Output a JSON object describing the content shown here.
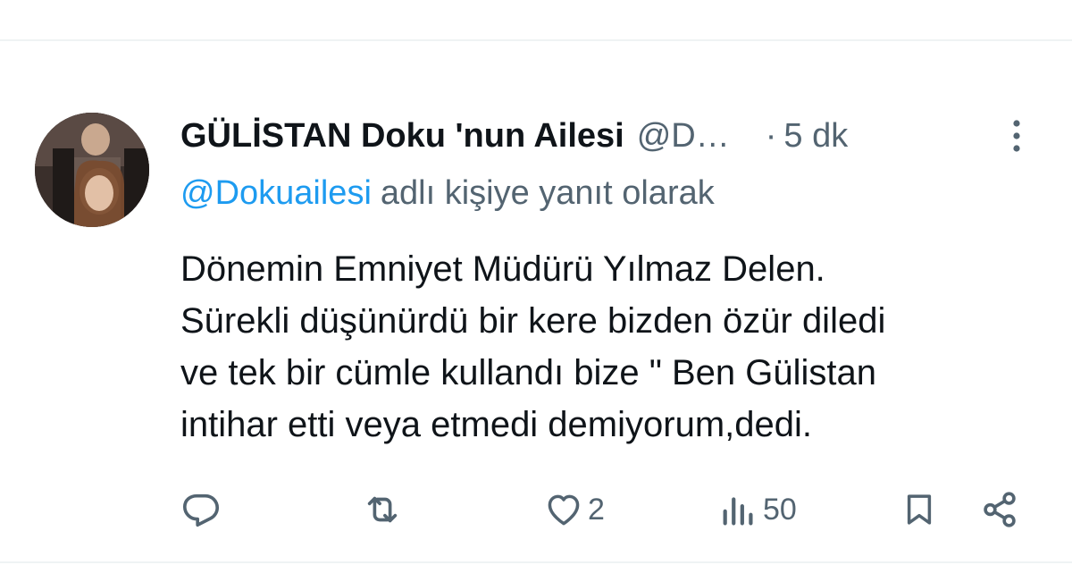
{
  "tweet": {
    "display_name": "GÜLİSTAN Doku 'nun Ailesi",
    "handle": "@Dokuailesi",
    "separator": "·",
    "time": "5 dk",
    "reply_to": {
      "mention": "@Dokuailesi",
      "suffix": "adlı kişiye yanıt olarak"
    },
    "body_lines": [
      "Dönemin Emniyet Müdürü Yılmaz Delen.",
      "Sürekli düşünürdü bir kere bizden özür diledi",
      "ve tek bir cümle kullandı bize \" Ben Gülistan",
      "intihar etti veya etmedi demiyorum,dedi."
    ]
  },
  "actions": {
    "reply": {
      "icon": "reply-icon"
    },
    "retweet": {
      "icon": "retweet-icon"
    },
    "like": {
      "icon": "heart-icon",
      "count": "2"
    },
    "views": {
      "icon": "views-icon",
      "count": "50"
    },
    "bookmark": {
      "icon": "bookmark-icon"
    },
    "share": {
      "icon": "share-icon"
    }
  },
  "colors": {
    "text": "#0f1419",
    "secondary": "#536471",
    "link": "#1d9bf0",
    "divider": "#eff3f4"
  }
}
